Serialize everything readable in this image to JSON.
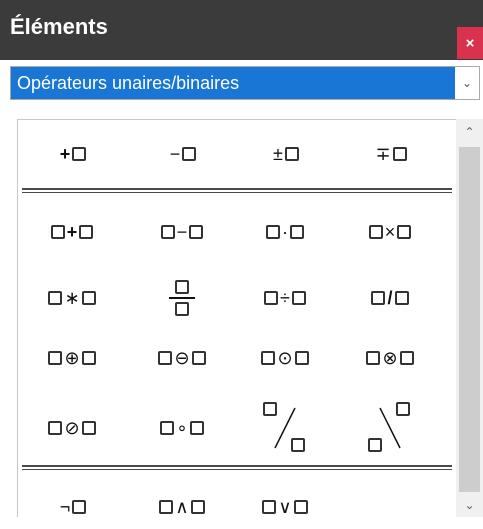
{
  "window": {
    "title": "Éléments",
    "close_label": "×"
  },
  "category": {
    "selected": "Opérateurs unaires/binaires"
  },
  "symbols": {
    "unary": [
      "+",
      "−",
      "±",
      "∓"
    ],
    "binary_row1": [
      "+",
      "−",
      "·",
      "×"
    ],
    "binary_row2": [
      "∗",
      "÷",
      "/"
    ],
    "binary_row3": [
      "⊕",
      "⊖",
      "⊙",
      "⊗"
    ],
    "binary_row4": [
      "⊘",
      "∘"
    ],
    "logic": [
      "¬",
      "∧",
      "∨"
    ]
  },
  "colors": {
    "titlebar": "#3b3b3b",
    "close": "#d8324f",
    "selection": "#1976d4"
  }
}
